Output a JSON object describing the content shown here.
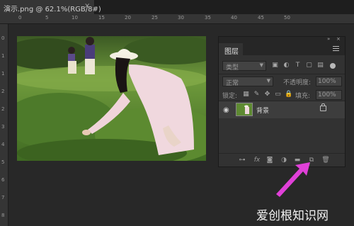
{
  "document_tab": {
    "title": "演示.png @ 62.1%(RGB/8#)",
    "close": "×"
  },
  "ruler": {
    "top_labels": [
      "0",
      "5",
      "10",
      "15",
      "20",
      "25",
      "30",
      "35",
      "40",
      "45",
      "50"
    ],
    "left_labels": [
      "0",
      "1",
      "1",
      "2",
      "2",
      "3",
      "4",
      "5",
      "6",
      "7",
      "8"
    ]
  },
  "layers_panel": {
    "tab_label": "图层",
    "collapse_icon": "»",
    "close_icon": "×",
    "filter": {
      "label": "类型"
    },
    "blend_mode": "正常",
    "opacity_label": "不透明度:",
    "opacity_value": "100%",
    "lock_label": "锁定:",
    "fill_label": "填充:",
    "fill_value": "100%",
    "layers": [
      {
        "name": "背景",
        "visible": true,
        "locked": true
      }
    ],
    "bottom_icons": [
      "link-layers",
      "fx",
      "add-mask",
      "adjustment-layer",
      "group-folder",
      "new-layer",
      "delete-layer"
    ]
  },
  "annotation": {
    "arrow_color": "#e040d8",
    "target": "new-layer-button"
  },
  "watermark": {
    "text": "爱创根知识网"
  }
}
